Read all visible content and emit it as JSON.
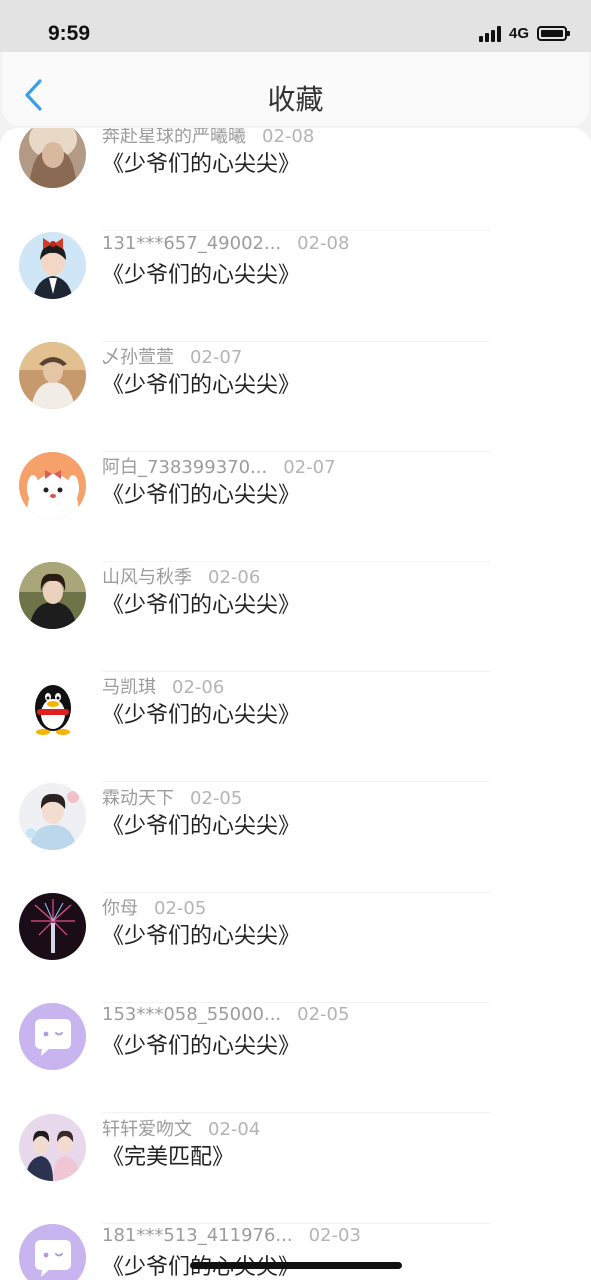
{
  "status": {
    "time": "9:59",
    "network": "4G"
  },
  "nav": {
    "title": "收藏"
  },
  "items": [
    {
      "name": "奔赴星球的严曦曦",
      "date": "02-08",
      "title": "《少爷们的心尖尖》"
    },
    {
      "name": "131***657_49002...",
      "date": "02-08",
      "title": "《少爷们的心尖尖》"
    },
    {
      "name": "乄孙萱萱",
      "date": "02-07",
      "title": "《少爷们的心尖尖》"
    },
    {
      "name": "阿白_738399370...",
      "date": "02-07",
      "title": "《少爷们的心尖尖》"
    },
    {
      "name": "山风与秋季",
      "date": "02-06",
      "title": "《少爷们的心尖尖》"
    },
    {
      "name": "马凯琪",
      "date": "02-06",
      "title": "《少爷们的心尖尖》"
    },
    {
      "name": "霖动天下",
      "date": "02-05",
      "title": "《少爷们的心尖尖》"
    },
    {
      "name": "你母",
      "date": "02-05",
      "title": "《少爷们的心尖尖》"
    },
    {
      "name": "153***058_55000...",
      "date": "02-05",
      "title": "《少爷们的心尖尖》"
    },
    {
      "name": "轩轩爱吻文",
      "date": "02-04",
      "title": "《完美匹配》"
    },
    {
      "name": "181***513_411976...",
      "date": "02-03",
      "title": "《少爷们的心尖尖》"
    }
  ],
  "colors": {
    "accent": "#3a9ee8",
    "default_avatar": "#c8b4ee"
  }
}
